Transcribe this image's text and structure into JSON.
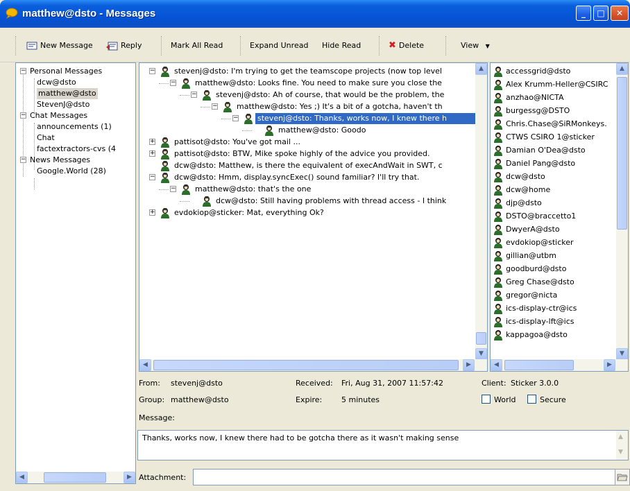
{
  "window": {
    "title": "matthew@dsto - Messages",
    "buttons": {
      "minimize": "_",
      "maximize": "□",
      "close": "✕"
    }
  },
  "toolbar": {
    "new_message": "New Message",
    "reply": "Reply",
    "mark_all_read": "Mark All Read",
    "expand_unread": "Expand Unread",
    "hide_read": "Hide Read",
    "delete": "Delete",
    "view": "View"
  },
  "folders": {
    "items": [
      {
        "label": "Personal Messages",
        "expander": "−"
      },
      {
        "label": "dcw@dsto"
      },
      {
        "label": "matthew@dsto"
      },
      {
        "label": "StevenJ@dsto"
      },
      {
        "label": "Chat Messages",
        "expander": "−"
      },
      {
        "label": "announcements (1)"
      },
      {
        "label": "Chat"
      },
      {
        "label": "factextractors-cvs (4"
      },
      {
        "label": "News Messages",
        "expander": "−"
      },
      {
        "label": "Google.World (28)"
      }
    ]
  },
  "threads": {
    "items": [
      {
        "text": "stevenj@dsto: I'm trying to get the teamscope projects (now top level",
        "expander": "−"
      },
      {
        "text": "matthew@dsto: Looks fine. You need to make sure you close the",
        "expander": "−"
      },
      {
        "text": "stevenj@dsto: Ah of course, that would be the problem, the",
        "expander": "−"
      },
      {
        "text": "matthew@dsto: Yes ;) It's a bit of a gotcha, haven't th",
        "expander": "−"
      },
      {
        "text": "stevenj@dsto: Thanks, works now, I knew there h",
        "expander": "−"
      },
      {
        "text": "matthew@dsto: Goodo"
      },
      {
        "text": "pattisot@dsto: You've got mail ...",
        "expander": "+"
      },
      {
        "text": "pattisot@dsto: BTW, Mike spoke highly of the advice you provided.",
        "expander": "+"
      },
      {
        "text": "dcw@dsto: Matthew, is there the equivalent of execAndWait in SWT, c"
      },
      {
        "text": "dcw@dsto: Hmm, display.syncExec() sound familiar? I'll try that.",
        "expander": "−"
      },
      {
        "text": "matthew@dsto: that's the one",
        "expander": "−"
      },
      {
        "text": "dcw@dsto: Still having problems with thread access - I think"
      },
      {
        "text": "evdokiop@sticker: Mat, everything Ok?",
        "expander": "+"
      }
    ]
  },
  "contacts": {
    "items": [
      "accessgrid@dsto",
      "Alex Krumm-Heller@CSIRC",
      "anzhao@NICTA",
      "burgessg@DSTO",
      "Chris.Chase@SiRMonkeys.",
      "CTWS CSIRO 1@sticker",
      "Damian O'Dea@dsto",
      "Daniel Pang@dsto",
      "dcw@dsto",
      "dcw@home",
      "djp@dsto",
      "DSTO@braccetto1",
      "DwyerA@dsto",
      "evdokiop@sticker",
      "gillian@utbm",
      "goodburd@dsto",
      "Greg Chase@dsto",
      "gregor@nicta",
      "ics-display-ctr@ics",
      "ics-display-lft@ics",
      "kappagoa@dsto"
    ]
  },
  "details": {
    "from_label": "From:",
    "from_value": "stevenj@dsto",
    "received_label": "Received:",
    "received_value": "Fri, Aug 31, 2007 11:57:42",
    "client_label": "Client:",
    "client_value": "Sticker 3.0.0",
    "group_label": "Group:",
    "group_value": "matthew@dsto",
    "expire_label": "Expire:",
    "expire_value": "5 minutes",
    "world_label": "World",
    "secure_label": "Secure",
    "message_label": "Message:",
    "message_text": "Thanks, works now, I knew there had to be gotcha there as it wasn't making sense",
    "attachment_label": "Attachment:"
  }
}
